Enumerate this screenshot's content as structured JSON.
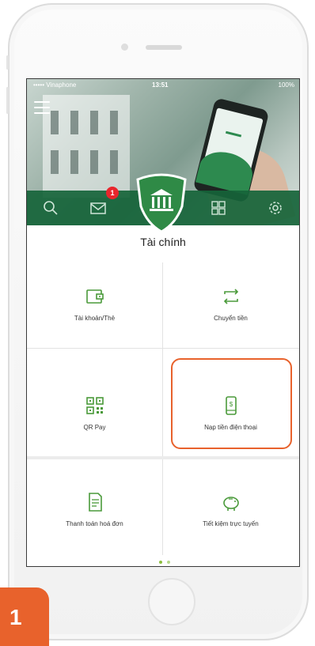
{
  "status": {
    "carrier": "••••• Vinaphone",
    "time": "13:51",
    "battery": "100%"
  },
  "nav": {
    "notification_count": "1"
  },
  "section": {
    "title": "Tài chính"
  },
  "tiles": [
    {
      "label": "Tài khoản/Thẻ"
    },
    {
      "label": "Chuyển tiền"
    },
    {
      "label": "QR Pay"
    },
    {
      "label": "Nạp tiền điện thoại"
    },
    {
      "label": "Thanh toán hoá đơn"
    },
    {
      "label": "Tiết kiệm trực tuyến"
    }
  ],
  "pager": {
    "active_color": "#8dbf3f",
    "inactive_color": "#b7d88a"
  },
  "step": {
    "number": "1"
  },
  "colors": {
    "brand_green": "#16643a",
    "accent_green": "#4a9a3a",
    "highlight_orange": "#e8622c"
  }
}
